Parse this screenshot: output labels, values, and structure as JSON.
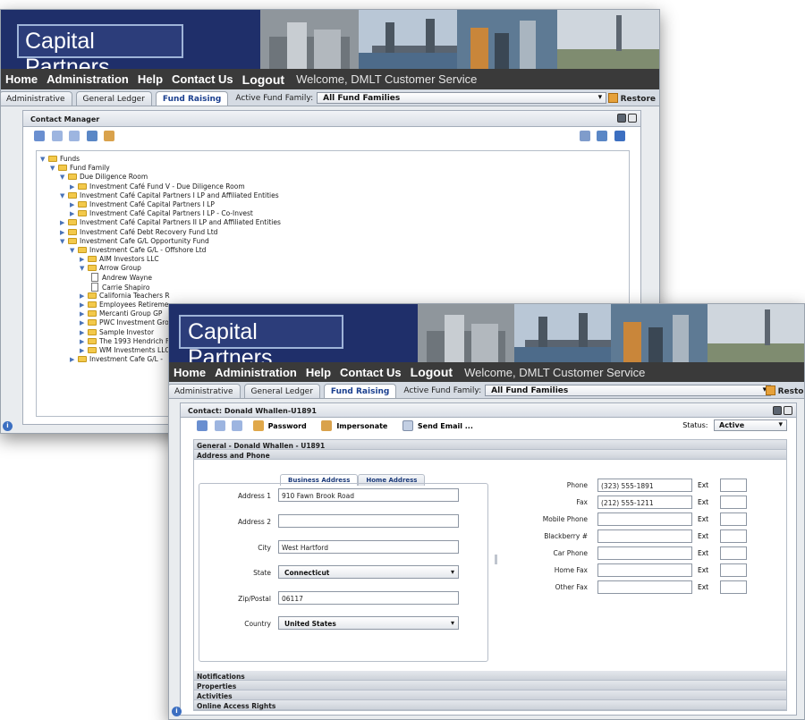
{
  "app_title": "Capital Partners",
  "nav": {
    "items": [
      "Home",
      "Administration",
      "Help",
      "Contact Us"
    ],
    "logout": "Logout",
    "welcome": "Welcome, DMLT Customer Service"
  },
  "tabs": [
    "Administrative",
    "General Ledger",
    "Fund Raising"
  ],
  "active_tab": "Fund Raising",
  "fund_family_label": "Active Fund Family:",
  "fund_family_value": "All Fund Families",
  "restore_label": "Restore",
  "contact_manager": {
    "title": "Contact Manager",
    "tree": [
      {
        "text": "Funds",
        "level": 0,
        "kind": "open"
      },
      {
        "text": "Fund Family",
        "level": 1,
        "kind": "open"
      },
      {
        "text": "Due Diligence Room",
        "level": 2,
        "kind": "open"
      },
      {
        "text": "Investment Café Fund V - Due Diligence Room",
        "level": 3,
        "kind": "closed"
      },
      {
        "text": "Investment Café Capital Partners I LP and Affiliated Entities",
        "level": 2,
        "kind": "open"
      },
      {
        "text": "Investment Café Capital Partners I LP",
        "level": 3,
        "kind": "closed"
      },
      {
        "text": "Investment Café Capital Partners I LP - Co-Invest",
        "level": 3,
        "kind": "closed"
      },
      {
        "text": "Investment Café Capital Partners II LP and Affiliated Entities",
        "level": 2,
        "kind": "closed"
      },
      {
        "text": "Investment Café Debt Recovery Fund Ltd",
        "level": 2,
        "kind": "closed"
      },
      {
        "text": "Investment Cafe G/L Opportunity Fund",
        "level": 2,
        "kind": "open"
      },
      {
        "text": "Investment Cafe G/L - Offshore Ltd",
        "level": 3,
        "kind": "open"
      },
      {
        "text": "AIM Investors LLC",
        "level": 4,
        "kind": "closed"
      },
      {
        "text": "Arrow Group",
        "level": 4,
        "kind": "open"
      },
      {
        "text": "Andrew Wayne",
        "level": 5,
        "kind": "doc"
      },
      {
        "text": "Carrie Shapiro",
        "level": 5,
        "kind": "doc"
      },
      {
        "text": "California Teachers R",
        "level": 4,
        "kind": "closed"
      },
      {
        "text": "Employees Retireme",
        "level": 4,
        "kind": "closed"
      },
      {
        "text": "Mercanti Group GP",
        "level": 4,
        "kind": "closed"
      },
      {
        "text": "PWC Investment Gro",
        "level": 4,
        "kind": "closed"
      },
      {
        "text": "Sample Investor",
        "level": 4,
        "kind": "closed"
      },
      {
        "text": "The 1993 Hendrich F",
        "level": 4,
        "kind": "closed"
      },
      {
        "text": "WM Investments LLC",
        "level": 4,
        "kind": "closed"
      },
      {
        "text": "Investment Cafe G/L -",
        "level": 3,
        "kind": "closed"
      }
    ]
  },
  "contact": {
    "title": "Contact: Donald Whallen-U1891",
    "toolbar": {
      "password": "Password",
      "impersonate": "Impersonate",
      "send_email": "Send Email ..."
    },
    "status_label": "Status:",
    "status_value": "Active",
    "sections": {
      "general": "General - Donald Whallen - U1891",
      "address_phone": "Address and Phone"
    },
    "address_tabs": [
      "Business Address",
      "Home Address"
    ],
    "address": {
      "address1_label": "Address 1",
      "address1": "910 Fawn Brook Road",
      "address2_label": "Address 2",
      "address2": "",
      "city_label": "City",
      "city": "West Hartford",
      "state_label": "State",
      "state": "Connecticut",
      "zip_label": "Zip/Postal",
      "zip": "06117",
      "country_label": "Country",
      "country": "United States"
    },
    "phones": [
      {
        "label": "Phone",
        "value": "(323) 555-1891",
        "ext_label": "Ext",
        "ext": ""
      },
      {
        "label": "Fax",
        "value": "(212) 555-1211",
        "ext_label": "Ext",
        "ext": ""
      },
      {
        "label": "Mobile Phone",
        "value": "",
        "ext_label": "Ext",
        "ext": ""
      },
      {
        "label": "Blackberry #",
        "value": "",
        "ext_label": "Ext",
        "ext": ""
      },
      {
        "label": "Car Phone",
        "value": "",
        "ext_label": "Ext",
        "ext": ""
      },
      {
        "label": "Home Fax",
        "value": "",
        "ext_label": "Ext",
        "ext": ""
      },
      {
        "label": "Other Fax",
        "value": "",
        "ext_label": "Ext",
        "ext": ""
      }
    ],
    "bottom_sections": [
      "Notifications",
      "Properties",
      "Activities",
      "Online Access Rights"
    ]
  },
  "info_icon": "i",
  "colors": {
    "banner": "#1f2f6a",
    "nav": "#3a3a3a",
    "tab_active": "#1a3f8f"
  }
}
